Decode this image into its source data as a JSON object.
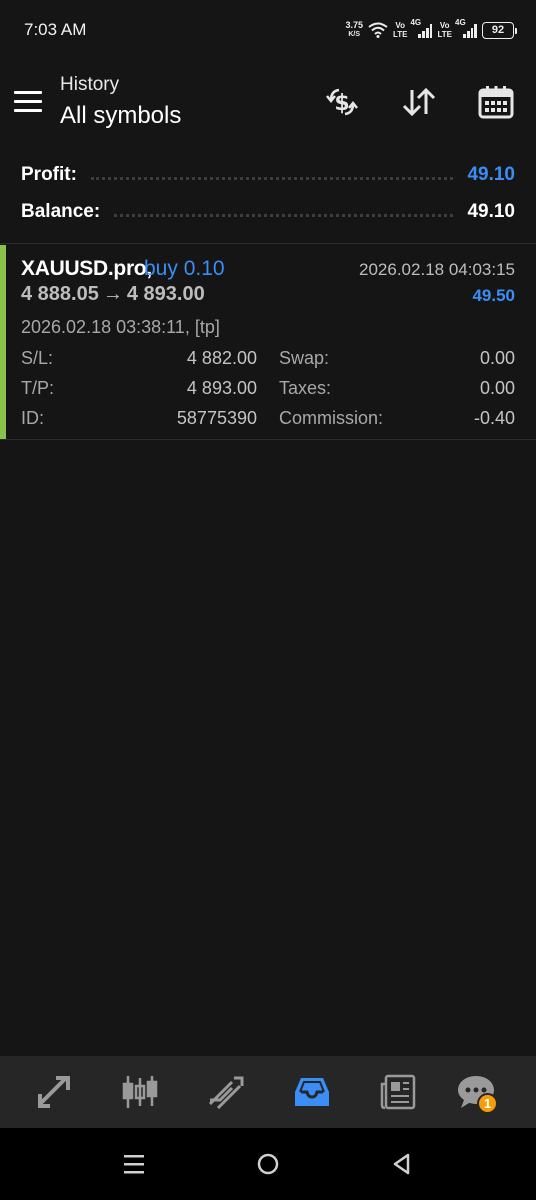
{
  "status_bar": {
    "time": "7:03 AM",
    "net_speed_value": "3.75",
    "net_speed_unit": "K/S",
    "volte_1_top": "Vo",
    "volte_1_bottom": "LTE",
    "network_1": "4G",
    "volte_2_top": "Vo",
    "volte_2_bottom": "LTE",
    "network_2": "4G",
    "battery": "92",
    "icons": [
      "wifi-icon",
      "signal-icon",
      "battery-icon"
    ]
  },
  "header": {
    "subtitle": "History",
    "title": "All symbols",
    "actions": [
      "currency-exchange-icon",
      "sort-icon",
      "calendar-icon"
    ]
  },
  "summary": {
    "profit_label": "Profit:",
    "profit_value": "49.10",
    "balance_label": "Balance:",
    "balance_value": "49.10"
  },
  "deal": {
    "symbol": "XAUUSD.pro,",
    "side": "buy 0.10",
    "close_time": "2026.02.18 04:03:15",
    "open_price": "4 888.05",
    "arrow": "→",
    "close_price": "4 893.00",
    "profit": "49.50",
    "open_time": "2026.02.18 03:38:11, [tp]",
    "rows": [
      {
        "label_left": "S/L:",
        "value_left": "4 882.00",
        "label_right": "Swap:",
        "value_right": "0.00"
      },
      {
        "label_left": "T/P:",
        "value_left": "4 893.00",
        "label_right": "Taxes:",
        "value_right": "0.00"
      },
      {
        "label_left": "ID:",
        "value_left": "58775390",
        "label_right": "Commission:",
        "value_right": "-0.40"
      }
    ],
    "accent_color": "#8bc34a"
  },
  "bottom_nav": {
    "items": [
      "quotes-icon",
      "chart-icon",
      "trade-icon",
      "history-icon",
      "news-icon",
      "messages-icon"
    ],
    "active": "history-icon",
    "messages_badge": "1"
  },
  "colors": {
    "background": "#151515",
    "accent_blue": "#3a8ef6",
    "badge_orange": "#f59d0b"
  }
}
